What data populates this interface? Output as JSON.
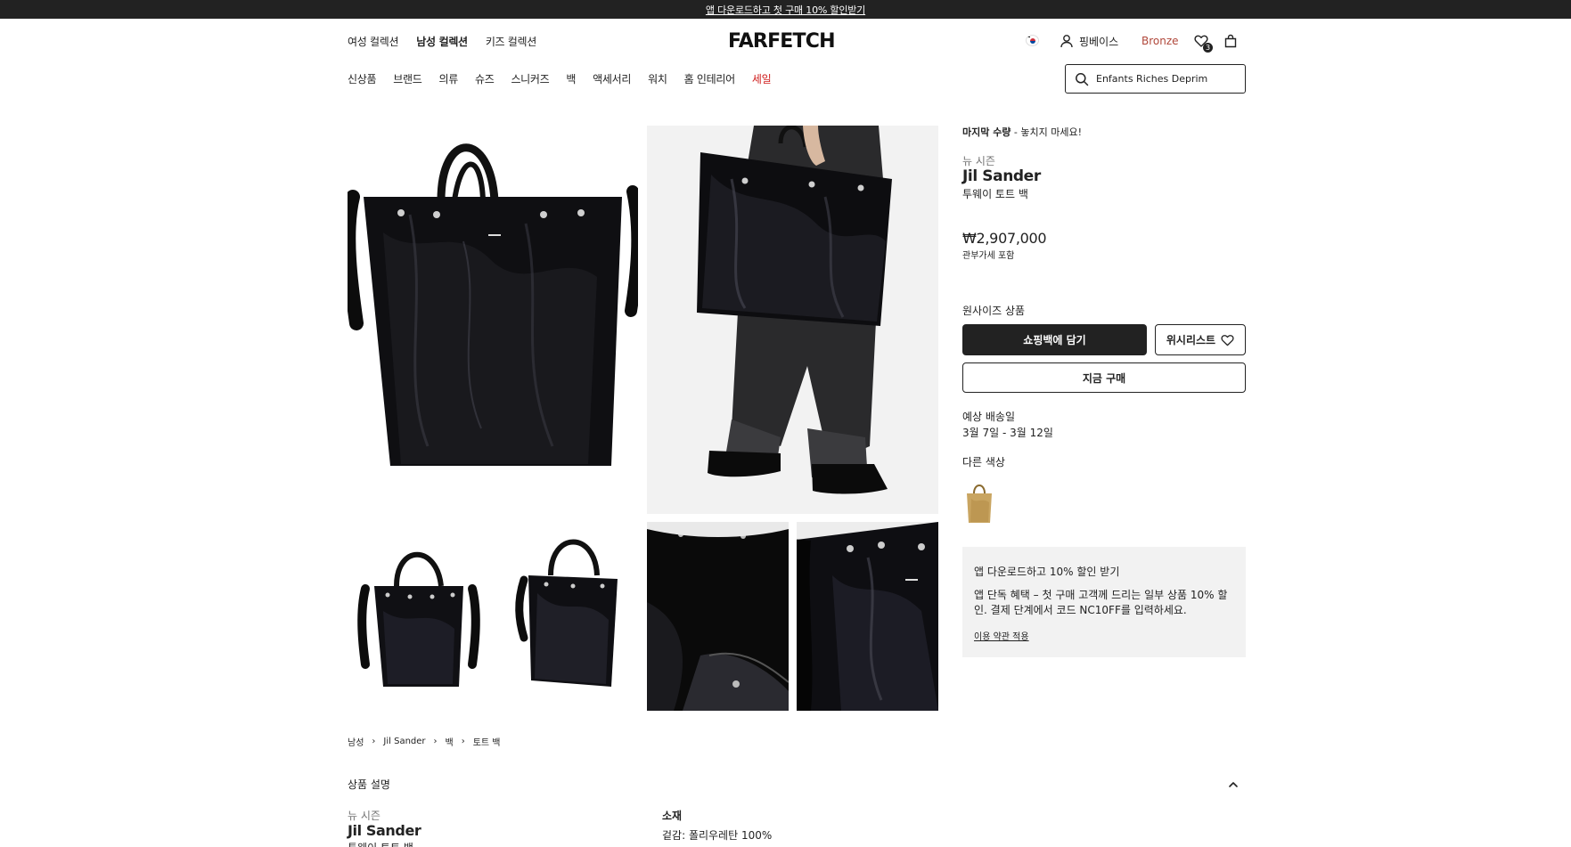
{
  "promo_bar": {
    "text": "앱 다운로드하고 첫 구매 10% 할인받기"
  },
  "header": {
    "gender_tabs": [
      "여성 컬렉션",
      "남성 컬렉션",
      "키즈 컬렉션"
    ],
    "active_gender": "남성 컬렉션",
    "logo": "FARFETCH",
    "user_label": "핑베이스",
    "tier": "Bronze",
    "wishlist_count": "3",
    "categories": [
      "신상품",
      "브랜드",
      "의류",
      "슈즈",
      "스니커즈",
      "백",
      "액세서리",
      "워치",
      "홈 인테리어"
    ],
    "sale_label": "세일",
    "search_value": "Enfants Riches Deprim"
  },
  "product": {
    "stock_bold": "마지막 수량",
    "stock_rest": " - 놓치지 마세요!",
    "season": "뉴 시즌",
    "brand": "Jil Sander",
    "name": "투웨이 토트 백",
    "price": "₩2,907,000",
    "price_note": "관부가세 포함",
    "size": "원사이즈 상품",
    "add_to_bag": "쇼핑백에 담기",
    "wishlist": "위시리스트",
    "buy_now": "지금 구매",
    "shipping_label": "예상 배송일",
    "shipping_date": "3월 7일 - 3월 12일",
    "other_colors_label": "다른 색상"
  },
  "promo_card": {
    "title": "앱 다운로드하고 10% 할인 받기",
    "body": "앱 단독 혜택 – 첫 구매 고객께 드리는 일부 상품 10% 할인. 결제 단계에서 코드 NC10FF를 입력하세요.",
    "link": "이용 약관 적용"
  },
  "breadcrumb": [
    "남성",
    "Jil Sander",
    "백",
    "토트 백"
  ],
  "description": {
    "toggle_label": "상품 설명",
    "season": "뉴 시즌",
    "brand": "Jil Sander",
    "name": "투웨이 토트 백",
    "material_title": "소재",
    "material_value": "겉감: 폴리우레탄 100%"
  },
  "colors": {
    "accent": "#222222",
    "sale": "#d0201f",
    "tier": "#b0473a",
    "promo_bg": "#f2f2f2"
  },
  "icons": [
    "search-icon",
    "user-icon",
    "heart-icon",
    "bag-icon",
    "chevron-up-icon",
    "flag-icon"
  ]
}
